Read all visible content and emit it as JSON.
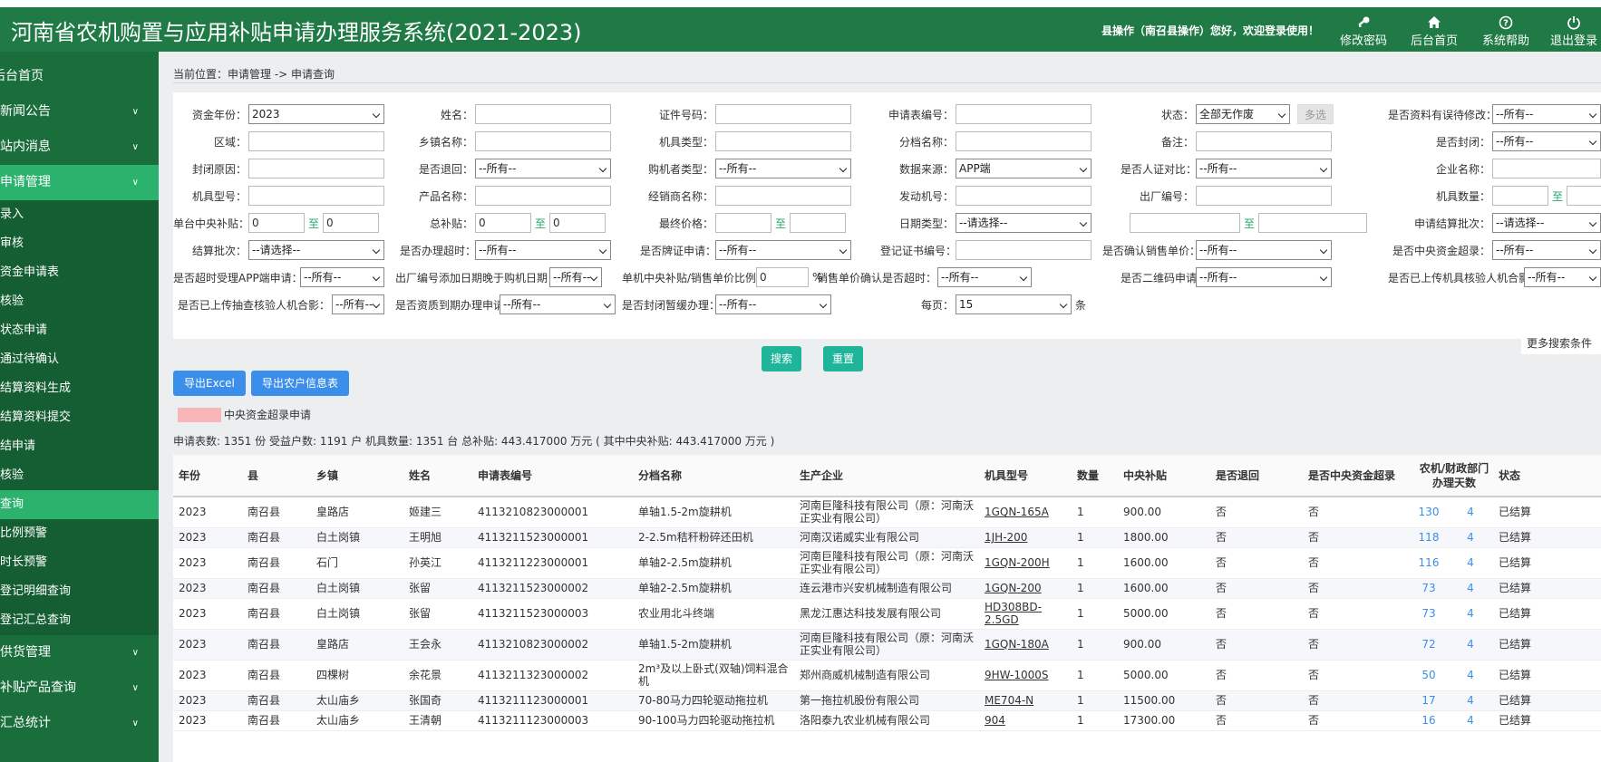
{
  "header": {
    "title": "河南省农机购置与应用补贴申请办理服务系统(2021-2023)",
    "welcome": "县操作（南召县操作）您好，欢迎登录使用！",
    "buttons": [
      {
        "label": "修改密码",
        "icon": "key-icon"
      },
      {
        "label": "后台首页",
        "icon": "home-icon"
      },
      {
        "label": "系统帮助",
        "icon": "help-icon"
      },
      {
        "label": "退出登录",
        "icon": "power-icon"
      }
    ]
  },
  "sidebar": {
    "home": "后台首页",
    "menus": [
      {
        "label": "新闻公告"
      },
      {
        "label": "站内消息"
      },
      {
        "label": "申请管理"
      }
    ],
    "sub_items": [
      "录入",
      "审核",
      "资金申请表",
      "核验",
      "状态申请",
      "通过待确认",
      "结算资料生成",
      "结算资料提交",
      "结申请",
      "核验",
      "查询",
      "比例预警",
      "时长预警",
      "登记明细查询",
      "登记汇总查询"
    ],
    "bottom_menus": [
      {
        "label": "供货管理"
      },
      {
        "label": "补贴产品查询"
      },
      {
        "label": "汇总统计"
      }
    ]
  },
  "breadcrumb": "当前位置：申请管理 -> 申请查询",
  "search": {
    "row1": {
      "fund_year_label": "资金年份：",
      "fund_year_value": "2023",
      "name_label": "姓名：",
      "id_label": "证件号码：",
      "app_no_label": "申请表编号：",
      "status_label": "状态：",
      "status_value": "全部无作废",
      "multi_label": "多选",
      "error_label": "是否资料有误待修改：",
      "error_value": "--所有--"
    },
    "row2": {
      "region_label": "区域：",
      "town_label": "乡镇名称：",
      "machine_type_label": "机具类型：",
      "grade_label": "分档名称：",
      "remark_label": "备注：",
      "closed_label": "是否封闭：",
      "closed_value": "--所有--"
    },
    "row3": {
      "close_reason_label": "封闭原因：",
      "returned_label": "是否退回：",
      "returned_value": "--所有--",
      "buyer_type_label": "购机者类型：",
      "buyer_type_value": "--所有--",
      "source_label": "数据来源：",
      "source_value": "APP端",
      "face_label": "是否人证对比：",
      "face_value": "--所有--",
      "company_label": "企业名称："
    },
    "row4": {
      "model_label": "机具型号：",
      "product_label": "产品名称：",
      "dealer_label": "经销商名称：",
      "engine_label": "发动机号：",
      "factory_no_label": "出厂编号：",
      "qty_label": "机具数量：",
      "to": "至"
    },
    "row5": {
      "unit_subsidy_label": "单台中央补贴：",
      "unit_from": "0",
      "unit_to": "0",
      "total_label": "总补贴：",
      "total_from": "0",
      "total_to": "0",
      "final_price_label": "最终价格：",
      "date_type_label": "日期类型：",
      "date_type_value": "--请选择--",
      "batch_label": "申请结算批次：",
      "batch_value": "--请选择--"
    },
    "row6": {
      "settle_batch_label": "结算批次：",
      "settle_batch_value": "--请选择--",
      "overtime_label": "是否办理超时：",
      "overtime_value": "--所有--",
      "plate_label": "是否牌证申请：",
      "plate_value": "--所有--",
      "cert_label": "登记证书编号：",
      "confirm_price_label": "是否确认销售单价：",
      "confirm_price_value": "--所有--",
      "central_over_label": "是否中央资金超录：",
      "central_over_value": "--所有--"
    },
    "row7": {
      "app_overtime_label": "是否超时受理APP端申请：",
      "app_overtime_value": "--所有--",
      "factory_date_label": "出厂编号添加日期晚于购机日期：",
      "factory_date_value": "--所有--",
      "ratio_label": "单机中央补贴/销售单价比例：",
      "ratio_value": "0",
      "ratio_unit": "%",
      "price_confirm_over_label": "销售单价确认是否超时：",
      "price_confirm_over_value": "--所有--",
      "qr_label": "是否二维码申请：",
      "qr_value": "--所有--",
      "photo_label": "是否已上传机具核验人机合影：",
      "photo_value": "--所有--"
    },
    "row8": {
      "spot_photo_label": "是否已上传抽查核验人机合影：",
      "spot_photo_value": "--所有--",
      "expire_label": "是否资质到期办理申请：",
      "expire_value": "--所有--",
      "close_pause_label": "是否封闭暂缓办理：",
      "close_pause_value": "--所有--",
      "per_page_label": "每页：",
      "per_page_value": "15",
      "per_page_unit": "条"
    },
    "more": "更多搜索条件",
    "search_btn": "搜索",
    "reset_btn": "重置"
  },
  "actions": {
    "export_excel": "导出Excel",
    "export_farmer": "导出农户信息表"
  },
  "legend": {
    "label": "中央资金超录申请",
    "color": "#f7b6b8"
  },
  "summary": "申请表数: 1351 份 受益户数: 1191 户 机具数量: 1351 台 总补贴: 443.417000 万元 ( 其中中央补贴: 443.417000 万元 )",
  "table": {
    "headers": [
      "年份",
      "县",
      "乡镇",
      "姓名",
      "申请表编号",
      "分档名称",
      "生产企业",
      "机具型号",
      "数量",
      "中央补贴",
      "是否退回",
      "是否中央资金超录",
      "农机/财政部门办理天数",
      "状态"
    ],
    "rows": [
      [
        "2023",
        "南召县",
        "皇路店",
        "姬建三",
        "4113210823000001",
        "单轴1.5-2m旋耕机",
        "河南巨隆科技有限公司（原：河南沃正实业有限公司）",
        "1GQN-165A",
        "1",
        "900.00",
        "否",
        "否",
        "130",
        "4",
        "已结算"
      ],
      [
        "2023",
        "南召县",
        "白土岗镇",
        "王明旭",
        "4113211523000001",
        "2-2.5m秸秆粉碎还田机",
        "河南汉诺威实业有限公司",
        "1JH-200",
        "1",
        "1800.00",
        "否",
        "否",
        "118",
        "4",
        "已结算"
      ],
      [
        "2023",
        "南召县",
        "石门",
        "孙英江",
        "4113211223000001",
        "单轴2-2.5m旋耕机",
        "河南巨隆科技有限公司（原：河南沃正实业有限公司）",
        "1GQN-200H",
        "1",
        "1600.00",
        "否",
        "否",
        "116",
        "4",
        "已结算"
      ],
      [
        "2023",
        "南召县",
        "白土岗镇",
        "张留",
        "4113211523000002",
        "单轴2-2.5m旋耕机",
        "连云港市兴安机械制造有限公司",
        "1GQN-200",
        "1",
        "1600.00",
        "否",
        "否",
        "73",
        "4",
        "已结算"
      ],
      [
        "2023",
        "南召县",
        "白土岗镇",
        "张留",
        "4113211523000003",
        "农业用北斗终端",
        "黑龙江惠达科技发展有限公司",
        "HD308BD-2.5GD",
        "1",
        "5000.00",
        "否",
        "否",
        "73",
        "4",
        "已结算"
      ],
      [
        "2023",
        "南召县",
        "皇路店",
        "王会永",
        "4113210823000002",
        "单轴1.5-2m旋耕机",
        "河南巨隆科技有限公司（原：河南沃正实业有限公司）",
        "1GQN-180A",
        "1",
        "900.00",
        "否",
        "否",
        "72",
        "4",
        "已结算"
      ],
      [
        "2023",
        "南召县",
        "四棵树",
        "余花景",
        "4113211323000002",
        "2m³及以上卧式(双轴)饲料混合机",
        "郑州商威机械制造有限公司",
        "9HW-1000S",
        "1",
        "5000.00",
        "否",
        "否",
        "50",
        "4",
        "已结算"
      ],
      [
        "2023",
        "南召县",
        "太山庙乡",
        "张国奇",
        "4113211123000001",
        "70-80马力四轮驱动拖拉机",
        "第一拖拉机股份有限公司",
        "ME704-N",
        "1",
        "11500.00",
        "否",
        "否",
        "17",
        "4",
        "已结算"
      ],
      [
        "2023",
        "南召县",
        "太山庙乡",
        "王清朝",
        "4113211123000003",
        "90-100马力四轮驱动拖拉机",
        "洛阳泰九农业机械有限公司",
        "904",
        "1",
        "17300.00",
        "否",
        "否",
        "16",
        "4",
        "已结算"
      ]
    ]
  }
}
